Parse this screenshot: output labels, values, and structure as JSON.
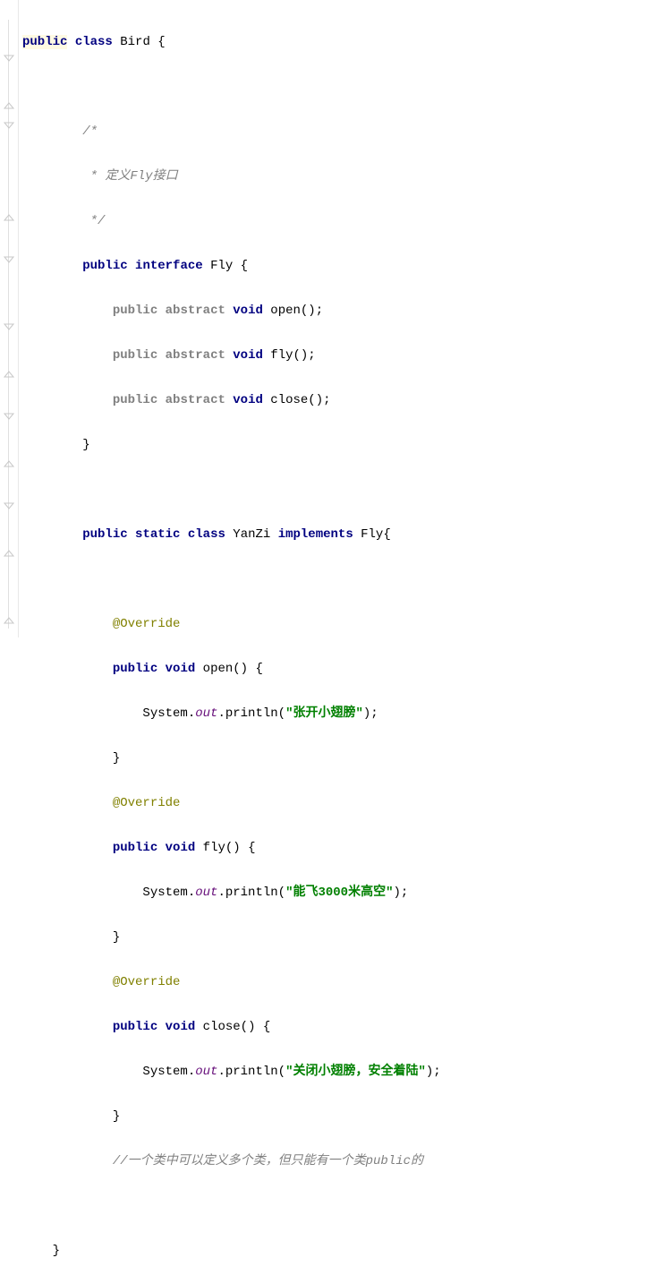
{
  "code": {
    "l1_kw_public": "public",
    "l1_kw_class": "class",
    "l1_name": " Bird {",
    "l3_c": "/*",
    "l4_c": " * 定义Fly接口",
    "l5_c": " */",
    "l6_kw_public": "public",
    "l6_kw_interface": "interface",
    "l6_name": " Fly {",
    "l7_kw_public": "public",
    "l7_kw_abstract": "abstract",
    "l7_kw_void": "void",
    "l7_name": " open();",
    "l8_kw_public": "public",
    "l8_kw_abstract": "abstract",
    "l8_kw_void": "void",
    "l8_name": " fly();",
    "l9_kw_public": "public",
    "l9_kw_abstract": "abstract",
    "l9_kw_void": "void",
    "l9_name": " close();",
    "l10_brace": "}",
    "l12_kw_public": "public",
    "l12_kw_static": "static",
    "l12_kw_class": "class",
    "l12_name1": " YanZi ",
    "l12_kw_implements": "implements",
    "l12_name2": " Fly{",
    "l14_ann": "@Override",
    "l15_kw_public": "public",
    "l15_kw_void": "void",
    "l15_name": " open() {",
    "l16_sys": "System.",
    "l16_out": "out",
    "l16_print": ".println(",
    "l16_str": "\"张开小翅膀\"",
    "l16_end": ");",
    "l17_brace": "}",
    "l18_ann": "@Override",
    "l19_kw_public": "public",
    "l19_kw_void": "void",
    "l19_name": " fly() {",
    "l20_sys": "System.",
    "l20_out": "out",
    "l20_print": ".println(",
    "l20_str": "\"能飞3000米高空\"",
    "l20_end": ");",
    "l21_brace": "}",
    "l22_ann": "@Override",
    "l23_kw_public": "public",
    "l23_kw_void": "void",
    "l23_name": " close() {",
    "l24_sys": "System.",
    "l24_out": "out",
    "l24_print": ".println(",
    "l24_str": "\"关闭小翅膀，安全着陆\"",
    "l24_end": ");",
    "l25_brace": "}",
    "l26_c": "//一个类中可以定义多个类，但只能有一个类public的",
    "l28_brace": "}"
  }
}
